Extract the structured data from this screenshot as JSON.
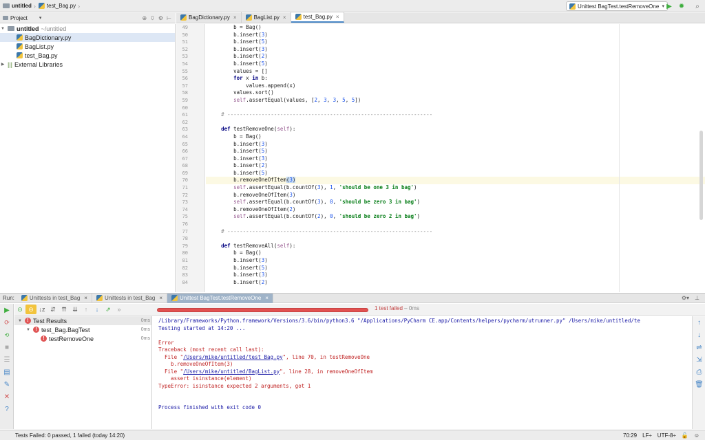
{
  "navbar": {
    "project": "untitled",
    "file": "test_Bag.py",
    "run_config": "Unittest BagTest.testRemoveOne"
  },
  "project_panel": {
    "title": "Project",
    "root": "untitled",
    "root_path": "~/untitled",
    "files": [
      "BagDictionary.py",
      "BagList.py",
      "test_Bag.py"
    ],
    "external": "External Libraries"
  },
  "editor_tabs": [
    "BagDictionary.py",
    "BagList.py",
    "test_Bag.py"
  ],
  "line_numbers": [
    "49",
    "50",
    "51",
    "52",
    "53",
    "54",
    "55",
    "56",
    "57",
    "58",
    "59",
    "60",
    "61",
    "62",
    "63",
    "64",
    "65",
    "66",
    "67",
    "68",
    "69",
    "70",
    "71",
    "72",
    "73",
    "74",
    "75",
    "76",
    "77",
    "78",
    "79",
    "80",
    "81",
    "82",
    "83",
    "84"
  ],
  "run_panel": {
    "label": "Run:",
    "tabs": [
      "Unittests in test_Bag",
      "Unittests in test_Bag",
      "Unittest BagTest.testRemoveOne"
    ],
    "progress": 1.0,
    "status": "1 test failed",
    "status_time": "0ms",
    "tree": {
      "root": "Test Results",
      "root_time": "0ms",
      "class": "test_Bag.BagTest",
      "class_time": "0ms",
      "test": "testRemoveOne",
      "test_time": "0ms"
    },
    "console": {
      "cmd": "/Library/Frameworks/Python.framework/Versions/3.6/bin/python3.6 \"/Applications/PyCharm CE.app/Contents/helpers/pycharm/utrunner.py\" /Users/mike/untitled/te",
      "started": "Testing started at 14:20 ...",
      "error": "Error",
      "traceback": "Traceback (most recent call last):",
      "file1_pre": "  File \"",
      "file1_link": "/Users/mike/untitled/test_Bag.py",
      "file1_post": "\", line 70, in testRemoveOne",
      "code1": "    b.removeOneOfItem(3)",
      "file2_pre": "  File \"",
      "file2_link": "/Users/mike/untitled/BagList.py",
      "file2_post": "\", line 28, in removeOneOfItem",
      "code2": "    assert isinstance(element)",
      "typeerror": "TypeError: isinstance expected 2 arguments, got 1",
      "finished": "Process finished with exit code 0"
    }
  },
  "statusbar": {
    "message": "Tests Failed: 0 passed, 1 failed (today 14:20)",
    "position": "70:29",
    "line_sep": "LF÷",
    "encoding": "UTF-8÷"
  }
}
